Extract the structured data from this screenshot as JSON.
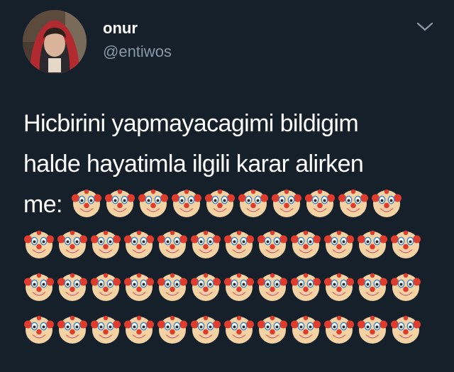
{
  "tweet": {
    "author": {
      "display_name": "onur",
      "handle": "@entiwos"
    },
    "more_icon": "chevron-down-icon",
    "text": {
      "line1": "Hicbirini yapmayacagimi bildigim",
      "line2": "halde hayatimla ilgili karar alirken",
      "line3_prefix": "me:"
    },
    "emoji": {
      "name": "clown-face-emoji",
      "count_first_line": 10,
      "count_per_full_row": 12,
      "full_rows": 3
    }
  },
  "colors": {
    "background": "#15202b",
    "text": "#ffffff",
    "secondary_text": "#8899a6"
  }
}
